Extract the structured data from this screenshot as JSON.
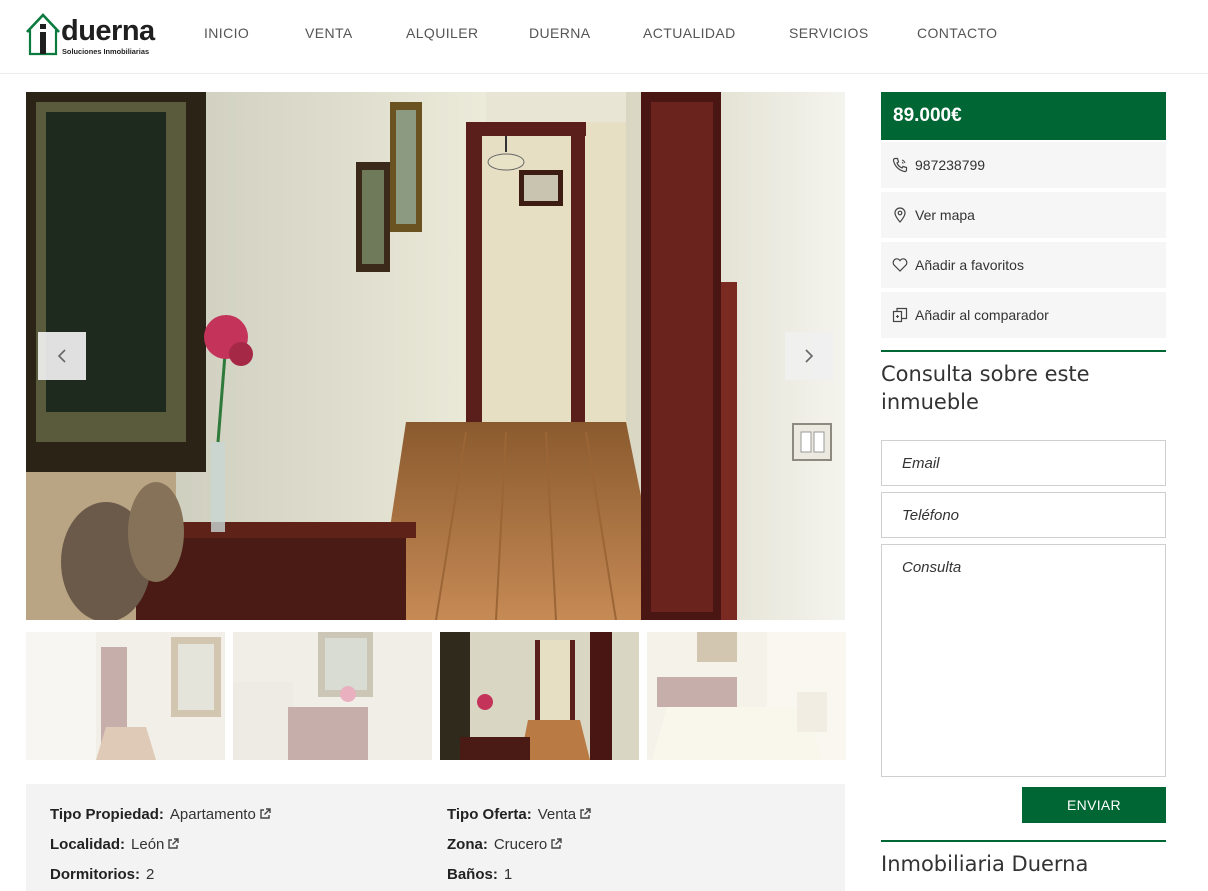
{
  "brand": {
    "logo_letter": "i",
    "name": "duerna",
    "tagline": "Soluciones Inmobiliarias",
    "accent_color": "#006633"
  },
  "nav": {
    "items": [
      {
        "label": "INICIO"
      },
      {
        "label": "VENTA"
      },
      {
        "label": "ALQUILER"
      },
      {
        "label": "DUERNA"
      },
      {
        "label": "ACTUALIDAD"
      },
      {
        "label": "SERVICIOS"
      },
      {
        "label": "CONTACTO"
      }
    ]
  },
  "gallery": {
    "prev_icon": "chevron-left-icon",
    "next_icon": "chevron-right-icon",
    "thumbnail_count": 4,
    "active_thumbnail": 3
  },
  "details": {
    "tipo_propiedad": {
      "label": "Tipo Propiedad:",
      "value": "Apartamento"
    },
    "tipo_oferta": {
      "label": "Tipo Oferta:",
      "value": "Venta"
    },
    "localidad": {
      "label": "Localidad:",
      "value": "León"
    },
    "zona": {
      "label": "Zona:",
      "value": "Crucero"
    },
    "dormitorios": {
      "label": "Dormitorios:",
      "value": "2"
    },
    "banos": {
      "label": "Baños:",
      "value": "1"
    }
  },
  "sidebar": {
    "price": "89.000€",
    "actions": {
      "phone": {
        "label": "987238799",
        "icon": "phone-icon"
      },
      "map": {
        "label": "Ver mapa",
        "icon": "map-pin-icon"
      },
      "favorites": {
        "label": "Añadir a favoritos",
        "icon": "heart-icon"
      },
      "compare": {
        "label": "Añadir al comparador",
        "icon": "compare-icon"
      }
    },
    "inquiry_title": "Consulta sobre este inmueble",
    "form": {
      "email_placeholder": "Email",
      "phone_placeholder": "Teléfono",
      "message_placeholder": "Consulta",
      "submit_label": "ENVIAR"
    },
    "agency_title": "Inmobiliaria Duerna"
  }
}
